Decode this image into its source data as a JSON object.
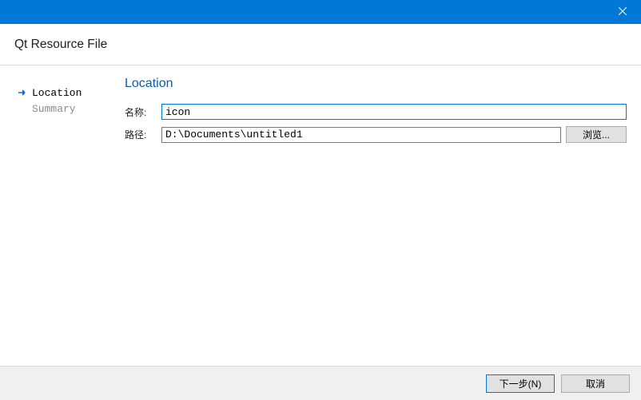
{
  "header": {
    "window_title": "Qt Resource File"
  },
  "sidebar": {
    "items": [
      {
        "label": "Location",
        "state": "active"
      },
      {
        "label": "Summary",
        "state": "pending"
      }
    ]
  },
  "main": {
    "section_title": "Location",
    "name_label": "名称:",
    "name_value": "icon",
    "path_label": "路径:",
    "path_value": "D:\\Documents\\untitled1",
    "browse_label": "浏览..."
  },
  "footer": {
    "next_label": "下一步(N)",
    "cancel_label": "取消"
  }
}
